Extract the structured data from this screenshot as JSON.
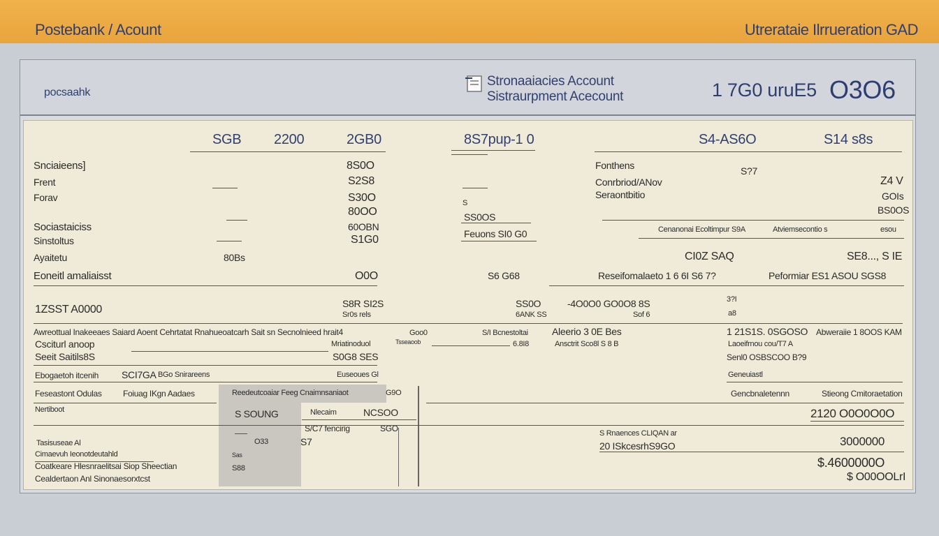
{
  "topbar": {
    "left_title": "Postebank / Acount",
    "right_title": "Utrerataie Ilrrueration GAD"
  },
  "header": {
    "brand": "pocsaahk",
    "title_1": "Stronaaiacies Account",
    "title_2": "Sistraurpment Acecount",
    "num_1": "1 7G0 uruE5",
    "num_2": "O3O6"
  },
  "sheet": {
    "top_row": [
      "SGB",
      "2200",
      "2GB0",
      "8S7pup-1 0",
      "S4-AS6O",
      "S14 s8s"
    ],
    "left_labels": [
      "Snciaieens]",
      "Frent",
      "Forav",
      "Sociastaiciss",
      "Sinstoltus",
      "Ayaitetu",
      "Eoneitl amaliaisst"
    ],
    "left_values": [
      "8S0O",
      "S2S8",
      "S30O",
      "80OO",
      "60OBN",
      "S1G0",
      "80Bs",
      "O0O"
    ],
    "mid_values": [
      "S",
      "SS0OS",
      "Feuons SI0 G0",
      "S6 G68"
    ],
    "right_labels": [
      "Fonthens",
      "Conrbriod/ANov",
      "Seraontbitio"
    ],
    "right_values": [
      "S?7",
      "Z4 V",
      "GOIs",
      "BS0OS",
      "Cenanonai Ecoltimpur S9A",
      "Atviemsecontio s",
      "esou",
      "CI0Z SAQ",
      "SE8..., S IE",
      "Reseifomalaeto 1 6 6I S6 7?",
      "Peformiar ES1 ASOU SGS8"
    ],
    "mid_block": {
      "a": "1ZSST A0000",
      "b": "S8R SI2S",
      "c": "Sr0s rels",
      "d": "SS0O",
      "e": "6ANK SS",
      "f": "-4O0O0 GO0O8 8S",
      "g": "Sof 6",
      "h": "3?I",
      "i": "a8"
    },
    "wide_row": {
      "a": "Awreottual Inakeeaes Saiard Aoent Cehrtatat Rnahueoatcarh Sait sn Secnolnieed hrait4",
      "b": "Goo0",
      "c": "S/I Bcnestoltai",
      "d": "Aleerio 3 0E Bes",
      "e": "1 21S1S. 0SGOSO",
      "f": "Abweraiie 1 8OOS KAM"
    },
    "row2": {
      "a": "Csciturl anoop",
      "b": "Mriatinoduol",
      "c": "Tsseaoob",
      "d": "6.8I8",
      "e": "Ansctrit Sco8l S 8 B",
      "f": "Laoeifrnou cou/T7 A"
    },
    "row3": {
      "a": "Seeit Saitils8S",
      "b": "S0G8 SES",
      "c": "Senl0 OSBSCOO B?9"
    },
    "row4": {
      "a": "Ebogaetoh itcenih",
      "b": "SCI7GA",
      "c": "BGo Snirareens",
      "d": "Euseoues Gl",
      "e": "Geneuiastl"
    },
    "row5": {
      "a": "Feseastont Odulas",
      "b": "Foiuag IKgn Aadaes",
      "c": "Reedeutcoaiar Feeg Cnaimnsaniaot",
      "d": "G9O",
      "e": "Gencbnaletennn",
      "f": "Stieong Cmitoraetation"
    },
    "bottom_left": {
      "a": "Nertiboot",
      "b": "S SOUNG",
      "c": "Nlecaim",
      "d": "NCSOO",
      "e": "S/C7 fencirig",
      "f": "SGO",
      "g": "Tasisuseae Al",
      "h": "O33",
      "i": "S7",
      "j": "Cimaevuh  Ieonotdeutahld",
      "k": "Coatkeare Hlesnraelitsai Siop Sheectian",
      "l": "Cealdertaon Anl Sinonaesorxtcst",
      "m": "Sas",
      "n": "S88"
    },
    "bottom_right": {
      "a": "2120 O0O0O0O",
      "b": "S Rnaences CLIQAN ar",
      "c": "20 ISkcesrhS9GO",
      "d": "3000000",
      "e": "$.4600000O",
      "f": "$ O00OOLrI"
    }
  }
}
